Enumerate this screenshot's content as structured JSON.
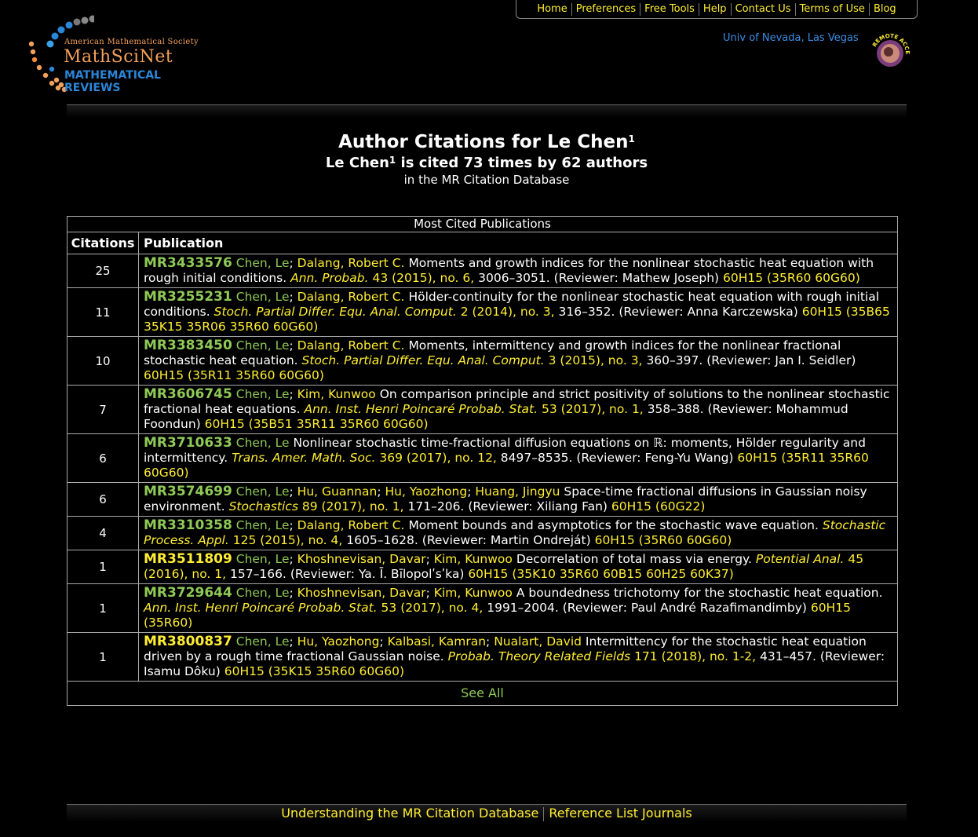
{
  "nav": [
    "Home",
    "Preferences",
    "Free Tools",
    "Help",
    "Contact Us",
    "Terms of Use",
    "Blog"
  ],
  "logo": {
    "line1": "American Mathematical Society",
    "line2": "MathSciNet",
    "line3": "MATHEMATICAL REVIEWS"
  },
  "institution": "Univ of Nevada, Las Vegas",
  "remote_access": "REMOTE ACCESS",
  "heading": {
    "title_prefix": "Author Citations for Le Chen",
    "title_sup": "1",
    "subtitle_name": "Le Chen",
    "subtitle_sup": "1",
    "subtitle_rest": " is cited 73 times by 62 authors",
    "note": "in the MR Citation Database"
  },
  "table": {
    "caption": "Most Cited Publications",
    "col_citations": "Citations",
    "col_publication": "Publication",
    "see_all": "See All"
  },
  "rows": [
    {
      "count": "25",
      "mr": "MR3433576",
      "mr_color": "green",
      "authors": [
        {
          "n": "Chen, Le",
          "c": "g"
        },
        {
          "n": "Dalang, Robert C.",
          "c": "y"
        }
      ],
      "title": "Moments and growth indices for the nonlinear stochastic heat equation with rough initial conditions.",
      "journal": "Ann. Probab.",
      "vol": "43 (2015), no. 6,",
      "pages": "3006–3051.",
      "reviewer": "(Reviewer: Mathew Joseph)",
      "class": "60H15 (35R60 60G60)"
    },
    {
      "count": "11",
      "mr": "MR3255231",
      "mr_color": "green",
      "authors": [
        {
          "n": "Chen, Le",
          "c": "g"
        },
        {
          "n": "Dalang, Robert C.",
          "c": "y"
        }
      ],
      "title": "Hölder-continuity for the nonlinear stochastic heat equation with rough initial conditions.",
      "journal": "Stoch. Partial Differ. Equ. Anal. Comput.",
      "vol": "2 (2014), no. 3,",
      "pages": "316–352.",
      "reviewer": "(Reviewer: Anna Karczewska)",
      "class": "60H15 (35B65 35K15 35R06 35R60 60G60)"
    },
    {
      "count": "10",
      "mr": "MR3383450",
      "mr_color": "green",
      "authors": [
        {
          "n": "Chen, Le",
          "c": "g"
        },
        {
          "n": "Dalang, Robert C.",
          "c": "y"
        }
      ],
      "title": "Moments, intermittency and growth indices for the nonlinear fractional stochastic heat equation.",
      "journal": "Stoch. Partial Differ. Equ. Anal. Comput.",
      "vol": "3 (2015), no. 3,",
      "pages": "360–397.",
      "reviewer": "(Reviewer: Jan I. Seidler)",
      "class": "60H15 (35R11 35R60 60G60)"
    },
    {
      "count": "7",
      "mr": "MR3606745",
      "mr_color": "green",
      "authors": [
        {
          "n": "Chen, Le",
          "c": "g"
        },
        {
          "n": "Kim, Kunwoo",
          "c": "y"
        }
      ],
      "title": "On comparison principle and strict positivity of solutions to the nonlinear stochastic fractional heat equations.",
      "journal": "Ann. Inst. Henri Poincaré Probab. Stat.",
      "vol": "53 (2017), no. 1,",
      "pages": "358–388.",
      "reviewer": "(Reviewer: Mohammud Foondun)",
      "class": "60H15 (35B51 35R11 35R60 60G60)"
    },
    {
      "count": "6",
      "mr": "MR3710633",
      "mr_color": "green",
      "authors": [
        {
          "n": "Chen, Le",
          "c": "g"
        }
      ],
      "title": "Nonlinear stochastic time-fractional diffusion equations on ℝ: moments, Hölder regularity and intermittency.",
      "journal": "Trans. Amer. Math. Soc.",
      "vol": "369 (2017), no. 12,",
      "pages": "8497–8535.",
      "reviewer": "(Reviewer: Feng-Yu Wang)",
      "class": "60H15 (35R11 35R60 60G60)"
    },
    {
      "count": "6",
      "mr": "MR3574699",
      "mr_color": "green",
      "authors": [
        {
          "n": "Chen, Le",
          "c": "g"
        },
        {
          "n": "Hu, Guannan",
          "c": "y"
        },
        {
          "n": "Hu, Yaozhong",
          "c": "y"
        },
        {
          "n": "Huang, Jingyu",
          "c": "y"
        }
      ],
      "title": "Space-time fractional diffusions in Gaussian noisy environment.",
      "journal": "Stochastics",
      "vol": "89 (2017), no. 1,",
      "pages": "171–206.",
      "reviewer": "(Reviewer: Xiliang Fan)",
      "class": "60H15 (60G22)"
    },
    {
      "count": "4",
      "mr": "MR3310358",
      "mr_color": "green",
      "authors": [
        {
          "n": "Chen, Le",
          "c": "g"
        },
        {
          "n": "Dalang, Robert C.",
          "c": "y"
        }
      ],
      "title": "Moment bounds and asymptotics for the stochastic wave equation.",
      "journal": "Stochastic Process. Appl.",
      "vol": "125 (2015), no. 4,",
      "pages": "1605–1628.",
      "reviewer": "(Reviewer: Martin Ondreját)",
      "class": "60H15 (35R60 60G60)"
    },
    {
      "count": "1",
      "mr": "MR3511809",
      "mr_color": "yellow",
      "authors": [
        {
          "n": "Chen, Le",
          "c": "g"
        },
        {
          "n": "Khoshnevisan, Davar",
          "c": "y"
        },
        {
          "n": "Kim, Kunwoo",
          "c": "y"
        }
      ],
      "title": "Decorrelation of total mass via energy.",
      "journal": "Potential Anal.",
      "vol": "45 (2016), no. 1,",
      "pages": "157–166.",
      "reviewer": "(Reviewer: Ya. Ī. Bīlopolʹsʹka)",
      "class": "60H15 (35K10 35R60 60B15 60H25 60K37)"
    },
    {
      "count": "1",
      "mr": "MR3729644",
      "mr_color": "green",
      "authors": [
        {
          "n": "Chen, Le",
          "c": "g"
        },
        {
          "n": "Khoshnevisan, Davar",
          "c": "y"
        },
        {
          "n": "Kim, Kunwoo",
          "c": "y"
        }
      ],
      "title": "A boundedness trichotomy for the stochastic heat equation.",
      "journal": "Ann. Inst. Henri Poincaré Probab. Stat.",
      "vol": "53 (2017), no. 4,",
      "pages": "1991–2004.",
      "reviewer": "(Reviewer: Paul André Razafimandimby)",
      "class": "60H15 (35R60)"
    },
    {
      "count": "1",
      "mr": "MR3800837",
      "mr_color": "yellow",
      "authors": [
        {
          "n": "Chen, Le",
          "c": "g"
        },
        {
          "n": "Hu, Yaozhong",
          "c": "y"
        },
        {
          "n": "Kalbasi, Kamran",
          "c": "y"
        },
        {
          "n": "Nualart, David",
          "c": "y"
        }
      ],
      "title": "Intermittency for the stochastic heat equation driven by a rough time fractional Gaussian noise.",
      "journal": "Probab. Theory Related Fields",
      "vol": "171 (2018), no. 1-2,",
      "pages": "431–457.",
      "reviewer": "(Reviewer: Isamu Dôku)",
      "class": "60H15 (35K15 35R60 60G60)"
    }
  ],
  "footer": [
    "Understanding the MR Citation Database",
    "Reference List Journals"
  ],
  "colors": {
    "link_yellow": "#ffee33",
    "link_green": "#8fc957",
    "blue": "#3a8ee6",
    "orange": "#f3a15a"
  }
}
